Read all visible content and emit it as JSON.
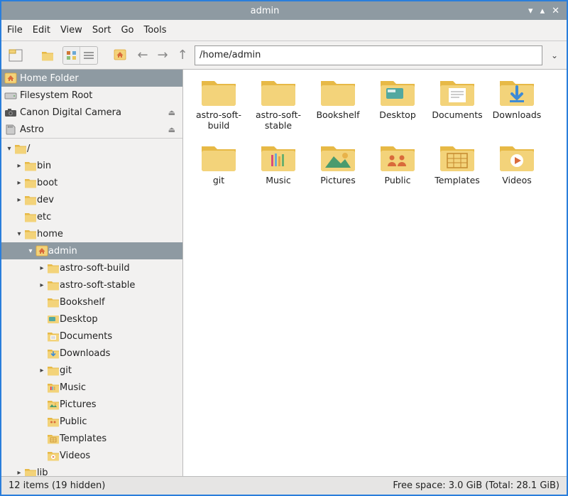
{
  "window": {
    "title": "admin"
  },
  "menu": {
    "file": "File",
    "edit": "Edit",
    "view": "View",
    "sort": "Sort",
    "go": "Go",
    "tools": "Tools"
  },
  "path": {
    "value": "/home/admin"
  },
  "places": {
    "home": "Home Folder",
    "fsroot": "Filesystem Root",
    "camera": "Canon Digital Camera",
    "astro": "Astro"
  },
  "tree": {
    "root": "/",
    "bin": "bin",
    "boot": "boot",
    "dev": "dev",
    "etc": "etc",
    "home": "home",
    "admin": "admin",
    "astro_soft_build": "astro-soft-build",
    "astro_soft_stable": "astro-soft-stable",
    "bookshelf": "Bookshelf",
    "desktop": "Desktop",
    "documents": "Documents",
    "downloads": "Downloads",
    "git": "git",
    "music": "Music",
    "pictures": "Pictures",
    "public": "Public",
    "templates": "Templates",
    "videos": "Videos",
    "lib": "lib"
  },
  "items": {
    "astro_soft_build": "astro-soft-build",
    "astro_soft_stable": "astro-soft-stable",
    "bookshelf": "Bookshelf",
    "desktop": "Desktop",
    "documents": "Documents",
    "downloads": "Downloads",
    "git": "git",
    "music": "Music",
    "pictures": "Pictures",
    "public": "Public",
    "templates": "Templates",
    "videos": "Videos"
  },
  "status": {
    "left": "12 items (19 hidden)",
    "right": "Free space: 3.0 GiB (Total: 28.1 GiB)"
  },
  "colors": {
    "folder": "#f3d37a",
    "folder_tab": "#e7b946",
    "selection": "#8e9aa2"
  }
}
